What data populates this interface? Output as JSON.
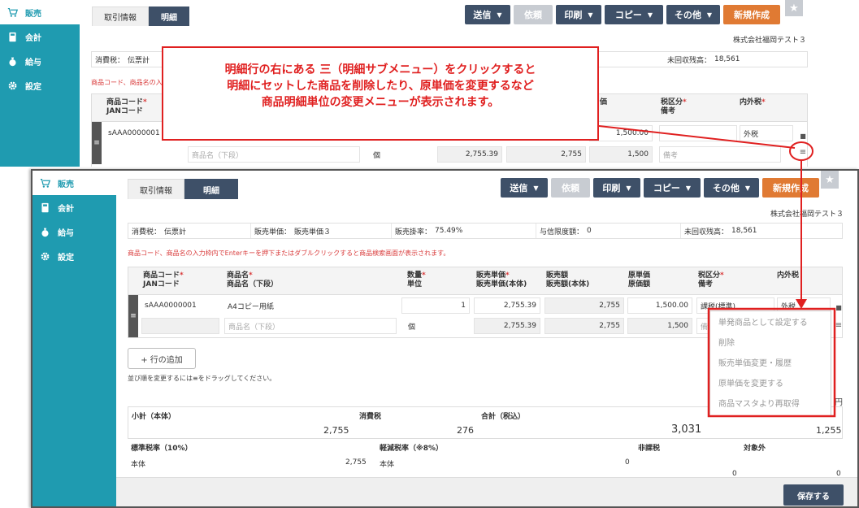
{
  "sidebar": {
    "items": [
      {
        "label": "販売",
        "icon": "cart-icon"
      },
      {
        "label": "会計",
        "icon": "calculator-icon"
      },
      {
        "label": "給与",
        "icon": "money-bag-icon"
      },
      {
        "label": "設定",
        "icon": "gear-icon"
      }
    ]
  },
  "tabs": {
    "transaction": "取引情報",
    "detail": "明細"
  },
  "toolbar": {
    "send": "送信",
    "request": "依頼",
    "print": "印刷",
    "copy": "コピー",
    "other": "その他",
    "new": "新規作成"
  },
  "company": "株式会社福岡テスト３",
  "info": {
    "tax_label": "消費税：",
    "tax_value": "伝票計",
    "unit_price_label": "販売単価：",
    "unit_price_value": "販売単価３",
    "rate_label": "販売掛率：",
    "rate_value": "75.49%",
    "credit_label": "与信限度額：",
    "credit_value": "0",
    "unpaid_label": "未回収残高：",
    "unpaid_value": "18,561"
  },
  "notice": "商品コード、商品名の入力枠内でEnterキーを押下またはダブルクリックすると商品検索画面が表示されます。",
  "notice_back": "商品コード、商品名の入",
  "columns": {
    "code": "商品コード",
    "jan": "JANコード",
    "name": "商品名",
    "name2": "商品名（下段）",
    "qty": "数量",
    "unit": "単位",
    "sale_price": "販売単価",
    "sale_price_net": "販売単価(本体)",
    "sale_amount": "販売額",
    "sale_amount_net": "販売額(本体)",
    "cost_price": "原単価",
    "cost_amount": "原価額",
    "tax_class": "税区分",
    "memo": "備考",
    "inner_tax": "内外税",
    "price_back": "価",
    "req": "*"
  },
  "row": {
    "code": "sAAA0000001",
    "name": "A4コピー用紙",
    "qty": "1",
    "sale_price": "2,755.39",
    "sale_amount": "2,755",
    "cost_price": "1,500.00",
    "tax_class": "課税(標準)",
    "inner_tax": "外税",
    "name2_placeholder": "商品名（下段）",
    "unit": "個",
    "sale_price_net": "2,755.39",
    "sale_amount_net": "2,755",
    "cost_amount": "1,500",
    "memo_placeholder": "備考",
    "memo_partial": "備"
  },
  "callout": {
    "line1": "明細行の右にある 三（明細サブメニュー）をクリックすると",
    "line2": "明細にセットした商品を削除したり、原単価を変更するなど",
    "line3": "商品明細単位の変更メニューが表示されます。"
  },
  "submenu": {
    "items": [
      "単発商品として設定する",
      "削除",
      "販売単価変更・履歴",
      "原単価を変更する",
      "商品マスタより再取得"
    ]
  },
  "add_row": "+ 行の追加",
  "drag_hint": "並び順を変更するには≡をドラッグしてください。",
  "totals": {
    "subtotal_label": "小計（本体）",
    "tax_label": "消費税",
    "total_label": "合計（税込）",
    "subtotal": "2,755",
    "tax": "276",
    "total": "3,031",
    "cost": "1,255",
    "yen": "円"
  },
  "tax_breakdown": {
    "standard": "標準税率（10%）",
    "reduced": "軽減税率（※8%）",
    "exempt": "非課税",
    "out_of_scope": "対象外",
    "body_label": "本体",
    "standard_body": "2,755",
    "reduced_body": "0",
    "exempt_zero": "0",
    "outside_zero": "0"
  },
  "save": "保存する"
}
